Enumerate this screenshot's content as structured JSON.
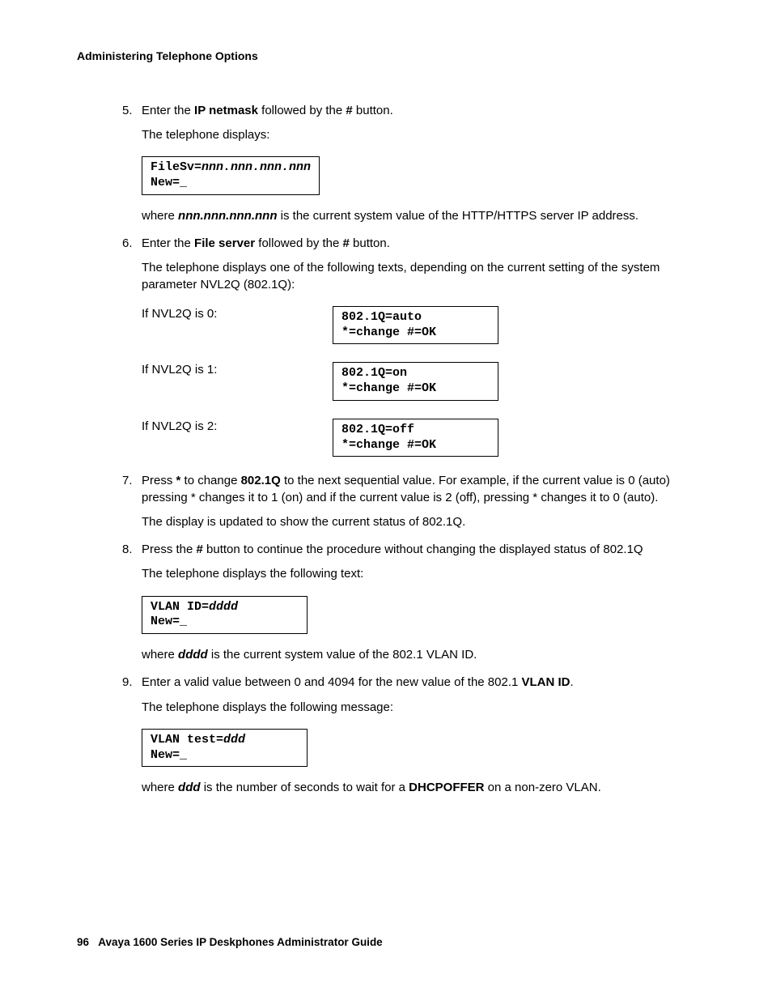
{
  "header": "Administering Telephone Options",
  "footer_page": "96",
  "footer_title": "Avaya 1600 Series IP Deskphones Administrator Guide",
  "step5": {
    "num": "5.",
    "line1_a": "Enter the ",
    "line1_b": "IP netmask",
    "line1_c": " followed by the ",
    "line1_d": "#",
    "line1_e": " button.",
    "sub1": "The telephone displays:",
    "box_l1a": "FileSv=",
    "box_l1b": "nnn.nnn.nnn.nnn",
    "box_l2": "New=_",
    "sub2_a": "where ",
    "sub2_b": "nnn.nnn.nnn.nnn",
    "sub2_c": " is the current system value of the HTTP/HTTPS server IP address."
  },
  "step6": {
    "num": "6.",
    "line1_a": "Enter the ",
    "line1_b": "File server",
    "line1_c": " followed by the ",
    "line1_d": "#",
    "line1_e": " button.",
    "sub1": "The telephone displays one of the following texts, depending on the current setting of the system parameter NVL2Q (802.1Q):",
    "row0_label": "If NVL2Q is 0:",
    "row0_box_l1": "802.1Q=auto",
    "row0_box_l2": "*=change #=OK",
    "row1_label": "If NVL2Q is 1:",
    "row1_box_l1": "802.1Q=on",
    "row1_box_l2": "*=change #=OK",
    "row2_label": "If NVL2Q is 2:",
    "row2_box_l1": "802.1Q=off",
    "row2_box_l2": "*=change #=OK"
  },
  "step7": {
    "num": "7.",
    "line1_a": "Press ",
    "line1_b": "*",
    "line1_c": " to change ",
    "line1_d": "802.1Q",
    "line1_e": " to the next sequential value. For example, if the current value is 0 (auto) pressing * changes it to 1 (on) and if the current value is 2 (off), pressing * changes it to 0 (auto).",
    "sub1": "The display is updated to show the current status of 802.1Q."
  },
  "step8": {
    "num": "8.",
    "line1_a": "Press the ",
    "line1_b": "#",
    "line1_c": " button to continue the procedure without changing the displayed status of 802.1Q",
    "sub1": "The telephone displays the following text:",
    "box_l1a": "VLAN ID=",
    "box_l1b": "dddd",
    "box_l2": "New=_",
    "sub2_a": "where ",
    "sub2_b": "dddd",
    "sub2_c": " is the current system value of the 802.1 VLAN ID."
  },
  "step9": {
    "num": "9.",
    "line1_a": "Enter a valid value between 0 and 4094 for the new value of the 802.1 ",
    "line1_b": "VLAN ID",
    "line1_c": ".",
    "sub1": "The telephone displays the following message:",
    "box_l1a": "VLAN test=",
    "box_l1b": "ddd",
    "box_l2": "New=_",
    "sub2_a": "where ",
    "sub2_b": "ddd",
    "sub2_c": " is the number of seconds to wait for a ",
    "sub2_d": "DHCPOFFER",
    "sub2_e": " on a non-zero VLAN."
  }
}
